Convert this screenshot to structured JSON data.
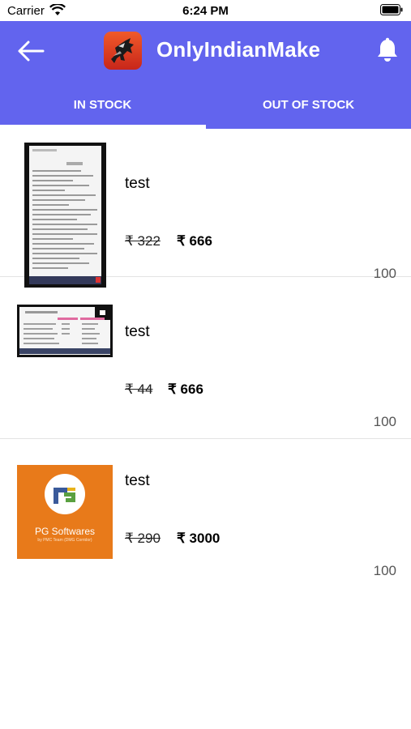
{
  "status_bar": {
    "carrier": "Carrier",
    "time": "6:24 PM"
  },
  "header": {
    "title": "OnlyIndianMake"
  },
  "tabs": [
    {
      "label": "IN STOCK"
    },
    {
      "label": "OUT OF STOCK"
    }
  ],
  "products": [
    {
      "name": "test",
      "old_price": "₹ 322",
      "new_price": "₹ 666",
      "quantity": "100"
    },
    {
      "name": "test",
      "old_price": "₹ 44",
      "new_price": "₹ 666",
      "quantity": "100"
    },
    {
      "name": "test",
      "old_price": "₹ 290",
      "new_price": "₹ 3000",
      "quantity": "100"
    }
  ],
  "thumbnail3": {
    "brand": "PG Softwares",
    "tagline": "by PMC Team (DMG Corridor)"
  },
  "colors": {
    "header_bg": "#6264ee",
    "thumb_orange": "#e87a1a"
  }
}
